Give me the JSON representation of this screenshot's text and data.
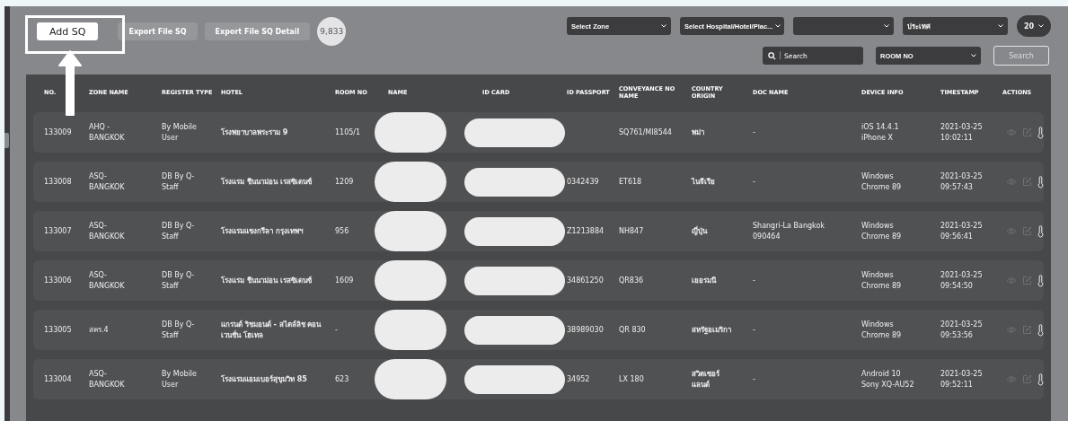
{
  "toolbar": {
    "add_button": "Add SQ",
    "export_buttons": [
      "Export File SQ",
      "Export File SQ Detail"
    ],
    "count": "9,833"
  },
  "filters": {
    "selects": [
      {
        "kind": "dropdown",
        "label": "Select Zone"
      },
      {
        "kind": "dropdown",
        "label": "Select Hospital/Hotel/Plac..."
      },
      {
        "kind": "dropdown"
      },
      {
        "kind": "dropdown",
        "label": "ประเทศ"
      }
    ],
    "page_size": "20",
    "search_placeholder": "Search",
    "search_by": "ROOM NO",
    "search_button": "Search"
  },
  "table": {
    "columns": [
      "NO.",
      "ZONE NAME",
      "REGISTER TYPE",
      "HOTEL",
      "ROOM NO",
      "NAME",
      "ID CARD",
      "ID PASSPORT",
      "CONVEYANCE NO NAME",
      "COUNTRY ORIGIN",
      "DOC NAME",
      "DEVICE INFO",
      "TIMESTAMP",
      "ACTIONS"
    ],
    "rows": [
      {
        "no": "133009",
        "zone": "AHQ -\nBANGKOK",
        "register_type": "By Mobile\nUser",
        "hotel": "โรงพยาบาลพระราม 9",
        "room": "1105/1",
        "passport": "",
        "conveyance": "SQ761/MI8544",
        "country": "พม่า",
        "doc": "-",
        "device": "iOS 14.4.1\niPhone X",
        "timestamp": "2021-03-25\n10:02:11"
      },
      {
        "no": "133008",
        "zone": "ASQ-\nBANGKOK",
        "register_type": "DB By Q-\nStaff",
        "hotel": "โรงแรม ชีนนาม่อน เรสซิเดนซ์",
        "room": "1209",
        "passport": "0342439",
        "conveyance": "ET618",
        "country": "ไนจีเรีย",
        "doc": "-",
        "device": "Windows\nChrome 89",
        "timestamp": "2021-03-25\n09:57:43"
      },
      {
        "no": "133007",
        "zone": "ASQ-\nBANGKOK",
        "register_type": "DB By Q-\nStaff",
        "hotel": "โรงแรมแชงกรีลา กรุงเทพฯ",
        "room": "956",
        "passport": "Z1213884",
        "conveyance": "NH847",
        "country": "ญี่ปุ่น",
        "doc": "Shangri-La Bangkok\n090464",
        "device": "Windows\nChrome 89",
        "timestamp": "2021-03-25\n09:56:41"
      },
      {
        "no": "133006",
        "zone": "ASQ-\nBANGKOK",
        "register_type": "DB By Q-\nStaff",
        "hotel": "โรงแรม ชีนนาม่อน เรสซิเดนซ์",
        "room": "1609",
        "passport": "34861250",
        "conveyance": "QR836",
        "country": "เยอรมนี",
        "doc": "-",
        "device": "Windows\nChrome 89",
        "timestamp": "2021-03-25\n09:54:50"
      },
      {
        "no": "133005",
        "zone": "สคร.4",
        "register_type": "DB By Q-\nStaff",
        "hotel": "แกรนด์ ริชมอนด์ - สไตล์ลิช คอนเวนชั่น โฮเทล",
        "room": "-",
        "passport": "38989030",
        "conveyance": "QR 830",
        "country": "สหรัฐอเมริกา",
        "doc": "-",
        "device": "Windows\nChrome 89",
        "timestamp": "2021-03-25\n09:53:56"
      },
      {
        "no": "133004",
        "zone": "ASQ-\nBANGKOK",
        "register_type": "By Mobile\nUser",
        "hotel": "โรงแรมแอมเบอร์สุขุมวิท 85",
        "room": "623",
        "passport": "34952",
        "conveyance": "LX 180",
        "country": "สวิตเซอร์\nแลนด์",
        "doc": "-",
        "device": "Android 10\nSony XQ-AU52",
        "timestamp": "2021-03-25\n09:52:11"
      }
    ]
  }
}
